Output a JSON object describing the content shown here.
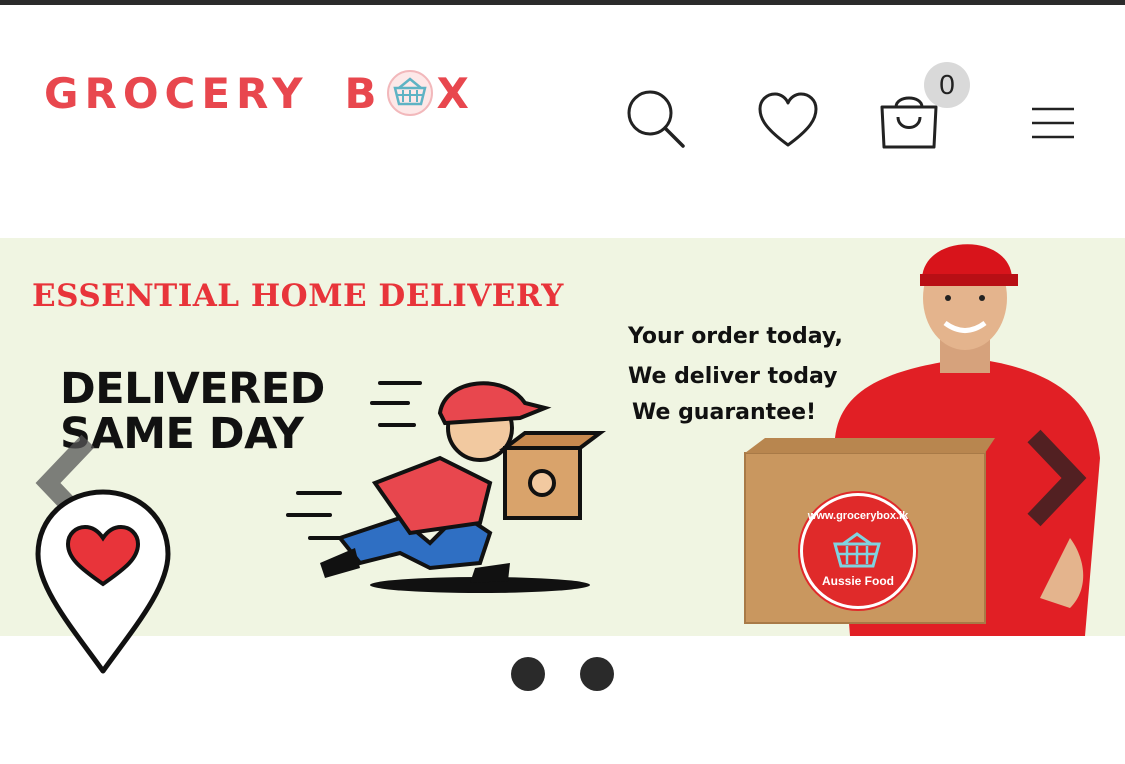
{
  "header": {
    "logo_text_1": "GROCERY",
    "logo_text_2": "B",
    "logo_text_3": "X",
    "cart_count": "0",
    "icons": [
      "search-icon",
      "heart-icon",
      "shopping-bag-icon",
      "hamburger-menu-icon"
    ]
  },
  "banner": {
    "title": "ESSENTIAL HOME DELIVERY",
    "headline_line1": "DELIVERED",
    "headline_line2": "SAME DAY",
    "tagline_1": "Your order today,",
    "tagline_2": "We deliver today",
    "tagline_3": "We guarantee!",
    "box_logo_top": "www.grocerybox.lk",
    "box_logo_bottom": "Aussie Food"
  },
  "slider": {
    "slide_count": 2
  },
  "floating": {
    "icon": "location-heart-pin-icon"
  },
  "colors": {
    "brand_red": "#e8474e",
    "banner_bg": "#f0f5e2",
    "teal": "#5fb3c4"
  }
}
